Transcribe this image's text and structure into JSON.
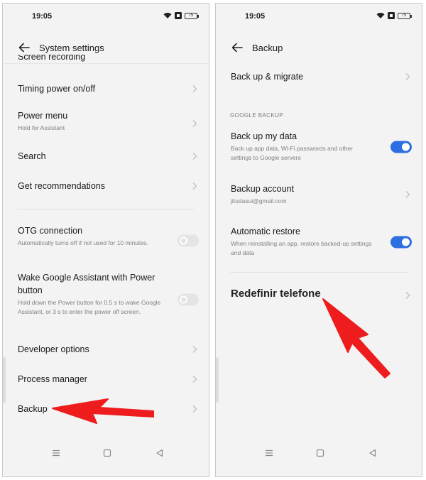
{
  "status": {
    "time": "19:05",
    "battery": "75"
  },
  "left": {
    "title": "System settings",
    "cut_item": "Screen recording",
    "items": [
      {
        "title": "Timing power on/off"
      },
      {
        "title": "Power menu",
        "subtitle": "Hold for Assistant"
      },
      {
        "title": "Search"
      },
      {
        "title": "Get recommendations"
      },
      {
        "title": "OTG connection",
        "subtitle": "Automatically turns off if not used for 10 minutes."
      },
      {
        "title": "Wake Google Assistant with Power button",
        "subtitle": "Hold down the Power button for 0.5 s to wake Google Assistant, or 3 s to enter the power off screen."
      },
      {
        "title": "Developer options"
      },
      {
        "title": "Process manager"
      },
      {
        "title": "Backup"
      }
    ]
  },
  "right": {
    "title": "Backup",
    "items": [
      {
        "title": "Back up & migrate"
      },
      {
        "title": "Back up my data",
        "subtitle": "Back up app data, Wi-Fi passwords and other settings to Google servers"
      },
      {
        "title": "Backup account",
        "subtitle": "jitudasui@gmail.com"
      },
      {
        "title": "Automatic restore",
        "subtitle": "When reinstalling an app, restore backed-up settings and data"
      },
      {
        "title": "Redefinir telefone"
      }
    ],
    "section_label": "GOOGLE BACKUP"
  },
  "colors": {
    "accent": "#2b6fe0",
    "arrow": "#ee1c1c"
  },
  "icons": [
    "back-arrow-icon",
    "chevron-right-icon",
    "wifi-icon",
    "notification-icon",
    "battery-icon",
    "menu-icon",
    "home-icon",
    "back-triangle-icon"
  ]
}
